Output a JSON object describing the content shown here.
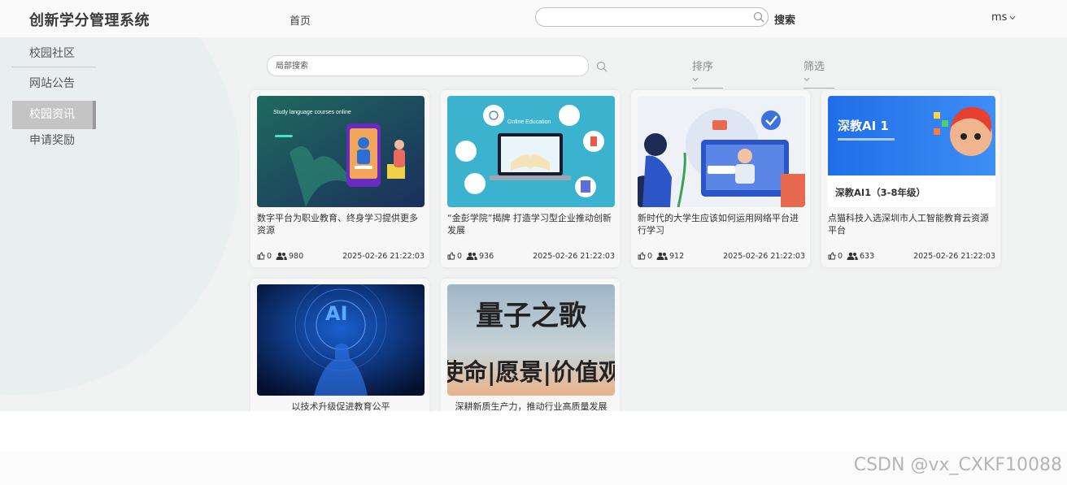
{
  "header": {
    "app_title": "创新学分管理系统",
    "nav_home": "首页",
    "search_value": "",
    "search_button": "搜索",
    "user": "ms"
  },
  "sidebar": {
    "items": [
      {
        "label": "校园社区"
      },
      {
        "label": "网站公告"
      },
      {
        "label": "校园资讯",
        "active": true
      },
      {
        "label": "申请奖励"
      }
    ]
  },
  "toolbar": {
    "local_search_placeholder": "局部搜索",
    "sort_label": "排序",
    "filter_label": "筛选"
  },
  "cards": [
    {
      "title": "数字平台为职业教育、终身学习提供更多资源",
      "likes": "0",
      "views": "980",
      "date": "2025-02-26 21:22:03",
      "image_text": "Study language courses online"
    },
    {
      "title": "“金彭学院”揭牌 打造学习型企业推动创新发展",
      "likes": "0",
      "views": "936",
      "date": "2025-02-26 21:22:03",
      "image_text": "Online Education"
    },
    {
      "title": "新时代的大学生应该如何运用网络平台进行学习",
      "likes": "0",
      "views": "912",
      "date": "2025-02-26 21:22:03",
      "image_text": ""
    },
    {
      "title": "点猫科技入选深圳市人工智能教育云资源平台",
      "likes": "0",
      "views": "633",
      "date": "2025-02-26 21:22:03",
      "image_text": "深教AI 1",
      "image_caption": "深教AI1（3-8年级）"
    },
    {
      "title": "以技术升级促进教育公平",
      "image_text": "AI"
    },
    {
      "title": "深耕新质生产力，推动行业高质量发展",
      "image_text_line1": "量子之歌",
      "image_text_line2": "使命|愿景|价值观"
    }
  ],
  "watermark": "CSDN @vx_CXKF10088",
  "colors": {
    "active_sidebar_bg": "#c4c4c4",
    "main_bg": "#f0f1f1"
  }
}
